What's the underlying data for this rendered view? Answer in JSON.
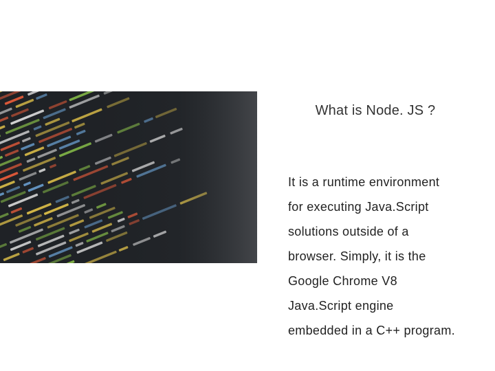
{
  "slide": {
    "title": "What is Node. JS ?",
    "body_lines": [
      "It is  a runtime environment",
      "for executing Java.Script",
      "solutions outside of a",
      "browser. Simply, it is the",
      "Google Chrome V8",
      "Java.Script engine",
      "embedded in a C++ program."
    ],
    "image": {
      "icon": "code-editor-photo",
      "colors": {
        "background": "#1f2226",
        "keyword": "#e05a3a",
        "string": "#e3c44a",
        "attr": "#d9d9d9",
        "accent": "#6fa8dc",
        "green": "#8bc34a"
      }
    }
  }
}
